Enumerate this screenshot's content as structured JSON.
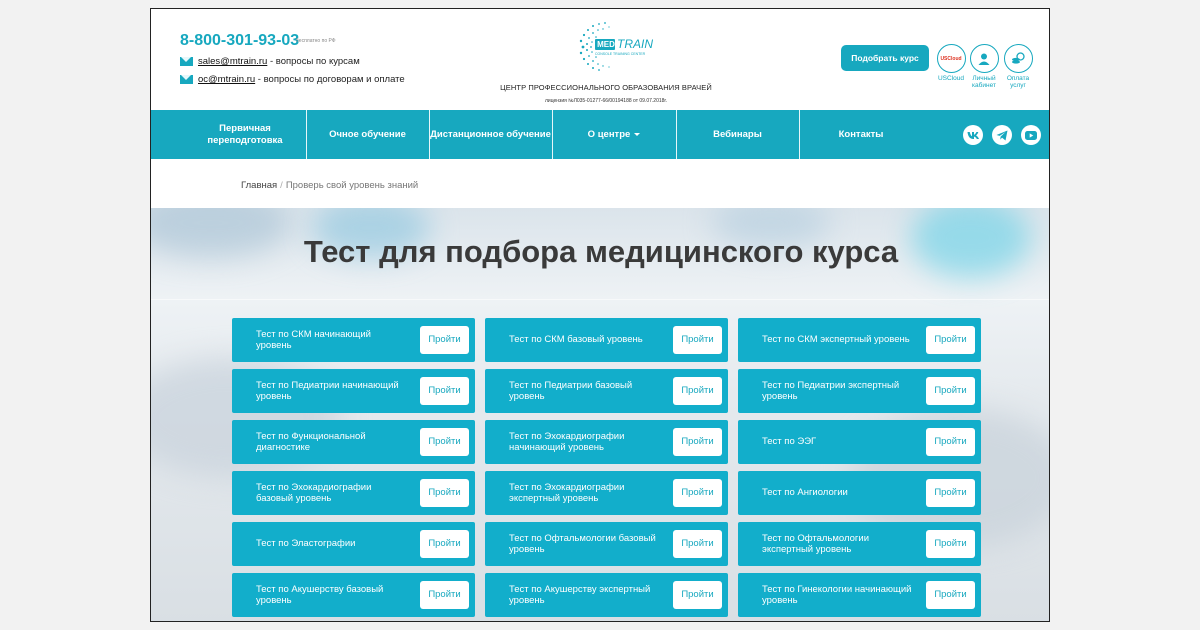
{
  "header": {
    "phone": "8-800-301-93-03",
    "phone_note": "бесплатно по РФ",
    "emails": [
      {
        "address": "sales@mtrain.ru",
        "text": " - вопросы по курсам"
      },
      {
        "address": "oc@mtrain.ru",
        "text": " - вопросы по договорам и оплате"
      }
    ],
    "logo": {
      "word1": "MED",
      "word2": "TRAIN",
      "tagline": "CONSOLE TRAINING CENTER"
    },
    "center_title": "ЦЕНТР ПРОФЕССИОНАЛЬНОГО ОБРАЗОВАНИЯ ВРАЧЕЙ",
    "license": "лицензия №Л035-01277-66/00194188 от 09.07.2018г.",
    "pick_course": "Подобрать курс",
    "tools": [
      {
        "icon": "uscloud-icon",
        "label": "USCloud",
        "badge": "USCloud"
      },
      {
        "icon": "user-icon",
        "label": "Личный кабинет"
      },
      {
        "icon": "coins-icon",
        "label": "Оплата услуг"
      }
    ]
  },
  "nav": [
    "Первичная переподготовка",
    "Очное обучение",
    "Дистанционное обучение",
    "О центре",
    "Вебинары",
    "Контакты"
  ],
  "breadcrumbs": {
    "home": "Главная",
    "sep": "/",
    "current": "Проверь свой уровень знаний"
  },
  "hero": {
    "title": "Тест для подбора медицинского курса"
  },
  "button_label": "Пройти",
  "tests": [
    [
      "Тест по СКМ начинающий уровень",
      "Тест по СКМ базовый уровень",
      "Тест по СКМ экспертный уровень"
    ],
    [
      "Тест по Педиатрии начинающий уровень",
      "Тест по Педиатрии базовый уровень",
      "Тест по Педиатрии экспертный уровень"
    ],
    [
      "Тест по Функциональной диагностике",
      "Тест по Эхокардиографии начинающий уровень",
      "Тест по ЭЭГ"
    ],
    [
      "Тест по Эхокардиографии базовый уровень",
      "Тест по Эхокардиографии экспертный уровень",
      "Тест по Ангиологии"
    ],
    [
      "Тест по Эластографии",
      "Тест по Офтальмологии базовый уровень",
      "Тест по Офтальмологии экспертный уровень"
    ],
    [
      "Тест по Акушерству базовый уровень",
      "Тест по Акушерству экспертный уровень",
      "Тест по Гинекологии начинающий уровень"
    ]
  ],
  "colors": {
    "accent": "#17a8bf",
    "card": "#12aecb",
    "title": "#3a3a3a"
  }
}
